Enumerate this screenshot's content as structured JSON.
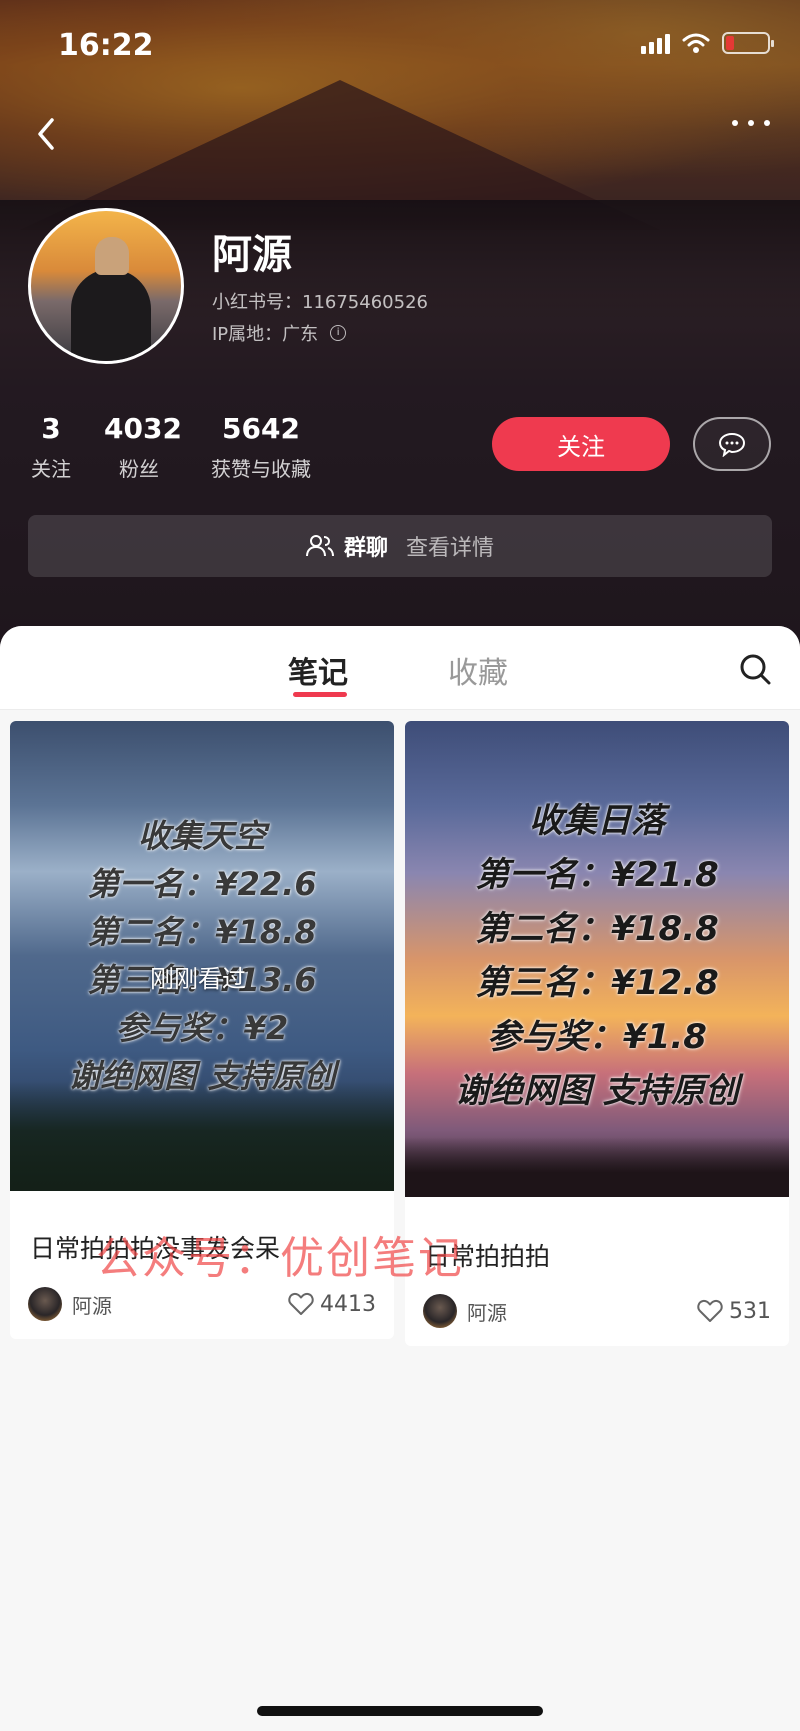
{
  "status": {
    "time": "16:22"
  },
  "profile": {
    "name": "阿源",
    "red_id": "小红书号：11675460526",
    "ip": "IP属地：广东",
    "info_icon": "i"
  },
  "stats": [
    {
      "value": "3",
      "label": "关注"
    },
    {
      "value": "4032",
      "label": "粉丝"
    },
    {
      "value": "5642",
      "label": "获赞与收藏"
    }
  ],
  "actions": {
    "follow_label": "关注"
  },
  "group": {
    "label": "群聊",
    "detail": "查看详情"
  },
  "tabs": {
    "notes": "笔记",
    "favorites": "收藏"
  },
  "notes": [
    {
      "cover_lines": [
        "收集天空",
        "第一名：¥22.6",
        "第二名：¥18.8",
        "第三名：¥13.6",
        "参与奖：¥2",
        "谢绝网图 支持原创"
      ],
      "overlay": "刚刚看过",
      "title": "日常拍拍拍没事发会呆",
      "author": "阿源",
      "likes": "4413"
    },
    {
      "cover_lines": [
        "收集日落",
        "第一名：¥21.8",
        "第二名：¥18.8",
        "第三名：¥12.8",
        "参与奖：¥1.8",
        "谢绝网图 支持原创"
      ],
      "title": "日常拍拍拍",
      "author": "阿源",
      "likes": "531"
    }
  ],
  "watermark": "公众号：优创笔记",
  "colors": {
    "accent": "#ef3a4f",
    "battery_low": "#e53935"
  },
  "icons": [
    "back-icon",
    "more-icon",
    "wifi-icon",
    "signal-icon",
    "battery-icon",
    "message-icon",
    "group-icon",
    "search-icon",
    "heart-icon",
    "info-icon"
  ]
}
